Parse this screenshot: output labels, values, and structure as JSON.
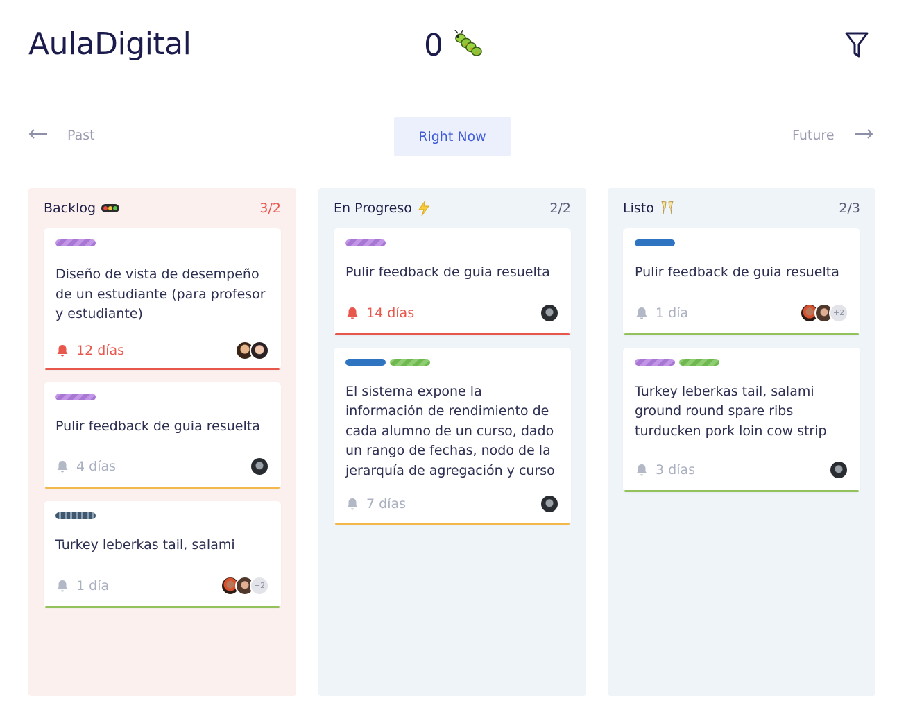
{
  "app": {
    "title": "AulaDigital",
    "counter": "0"
  },
  "nav": {
    "past": "Past",
    "now": "Right Now",
    "future": "Future"
  },
  "colors": {
    "urgent": "#e8574c",
    "warning": "#f2b84b",
    "ok": "#93c15b",
    "accent": "#3d5ad8"
  },
  "columns": [
    {
      "title": "Backlog",
      "emoji": "traffic-light-icon",
      "count": "3/2",
      "cards": [
        {
          "tags": [
            "purple"
          ],
          "text": "Diseño de vista de desempeño de un estudiante (para profesor y estudiante)",
          "due": "12 días",
          "status": "urgent",
          "avatars": [
            "a",
            "b"
          ]
        },
        {
          "tags": [
            "purple"
          ],
          "text": "Pulir feedback de guia resuelta",
          "due": "4 días",
          "status": "warning",
          "avatars": [
            "d"
          ]
        },
        {
          "tags": [
            "gray"
          ],
          "text": "Turkey leberkas tail, salami",
          "due": "1 día",
          "status": "ok",
          "avatars": [
            "c",
            "e"
          ],
          "more": "+2"
        }
      ]
    },
    {
      "title": "En Progreso",
      "emoji": "lightning-icon",
      "count": "2/2",
      "cards": [
        {
          "tags": [
            "purple"
          ],
          "text": "Pulir feedback de guia resuelta",
          "due": "14 días",
          "status": "urgent",
          "avatars": [
            "d"
          ]
        },
        {
          "tags": [
            "blue",
            "green"
          ],
          "text": "El sistema expone la información de rendimiento de cada alumno de un curso, dado un rango de fechas, nodo de la jerarquía de agregación y curso",
          "due": "7 días",
          "status": "warning",
          "avatars": [
            "d"
          ]
        }
      ]
    },
    {
      "title": "Listo",
      "emoji": "champagne-icon",
      "count": "2/3",
      "cards": [
        {
          "tags": [
            "blue"
          ],
          "text": "Pulir feedback de guia resuelta",
          "due": "1 día",
          "status": "ok",
          "avatars": [
            "c",
            "e"
          ],
          "more": "+2"
        },
        {
          "tags": [
            "purple",
            "green"
          ],
          "text": "Turkey leberkas tail, salami ground round spare ribs turducken pork loin cow strip",
          "due": "3 días",
          "status": "ok",
          "avatars": [
            "d"
          ]
        }
      ]
    }
  ]
}
